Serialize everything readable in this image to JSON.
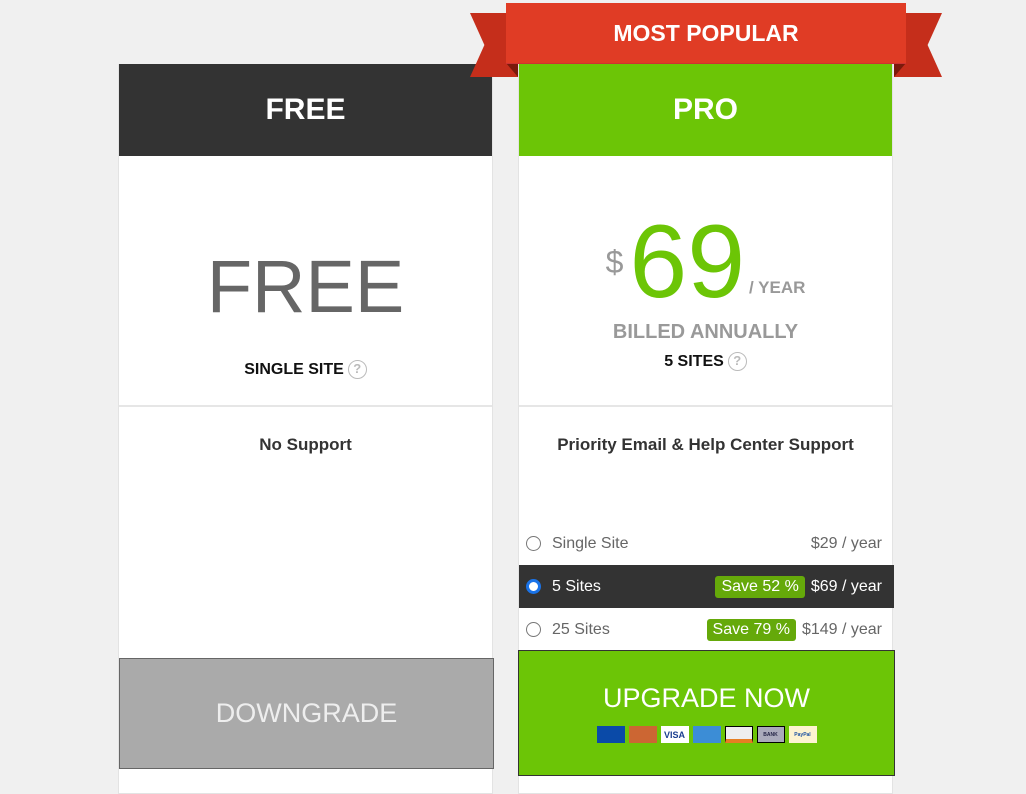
{
  "ribbon": "MOST POPULAR",
  "free": {
    "title": "FREE",
    "price": "FREE",
    "sites": "SINGLE SITE",
    "support": "No Support",
    "button": "DOWNGRADE"
  },
  "pro": {
    "title": "PRO",
    "currency": "$",
    "price": "69",
    "period": "/ YEAR",
    "billed": "BILLED ANNUALLY",
    "sites": "5 SITES",
    "support": "Priority Email & Help Center Support",
    "options": [
      {
        "label": "Single Site",
        "save": "",
        "price": "$29 / year",
        "selected": false
      },
      {
        "label": "5 Sites",
        "save": "Save 52 %",
        "price": "$69 / year",
        "selected": true
      },
      {
        "label": "25 Sites",
        "save": "Save 79 %",
        "price": "$149 / year",
        "selected": false
      }
    ],
    "button": "UPGRADE NOW",
    "payment_icons": [
      "maestro",
      "mastercard",
      "visa",
      "amex",
      "discover",
      "bank",
      "paypal"
    ]
  },
  "colors": {
    "green": "#6cc506",
    "dark": "#333333",
    "ribbon": "#e03c25",
    "save": "#65a90a"
  },
  "help_icon": "?"
}
